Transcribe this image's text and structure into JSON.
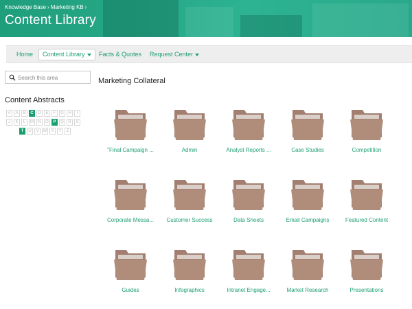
{
  "breadcrumb": {
    "items": [
      "Knowledge Base",
      "Marketing KB"
    ],
    "separator": "›"
  },
  "header": {
    "title": "Content Library"
  },
  "nav": {
    "items": [
      {
        "label": "Home"
      },
      {
        "label": "Content Library"
      },
      {
        "label": "Facts & Quotes"
      },
      {
        "label": "Request Center"
      }
    ]
  },
  "sidebar": {
    "search_placeholder": "Search this area",
    "abstracts_title": "Content Abstracts",
    "letters_row1": [
      "#",
      "A",
      "B",
      "C",
      "D",
      "E",
      "F",
      "G",
      "H",
      "I"
    ],
    "letters_row2": [
      "J",
      "K",
      "L",
      "M",
      "N",
      "O",
      "P",
      "Q",
      "R",
      "S"
    ],
    "letters_row3": [
      "T",
      "U",
      "V",
      "W",
      "X",
      "Y",
      "Z"
    ],
    "active_letters": [
      "C",
      "P",
      "T"
    ]
  },
  "main": {
    "section_title": "Marketing Collateral",
    "folders": [
      "\"Final Campaign ...",
      "Admin",
      "Analyst Reports ...",
      "Case Studies",
      "Competition",
      "Corporate Messa...",
      "Customer Success",
      "Data Sheets",
      "Email Campaigns",
      "Featured Content",
      "Guides",
      "Infographics",
      "Intranet Engage...",
      "Market Research",
      "Presentations"
    ]
  },
  "colors": {
    "banner": "#26a887",
    "link": "#1e9e74",
    "active_letter": "#17a06e",
    "folder_front": "#b08c7b",
    "folder_back": "#a27f70"
  },
  "icons": {
    "search": "search-icon",
    "folder": "folder-icon",
    "caret": "caret-down-icon"
  }
}
